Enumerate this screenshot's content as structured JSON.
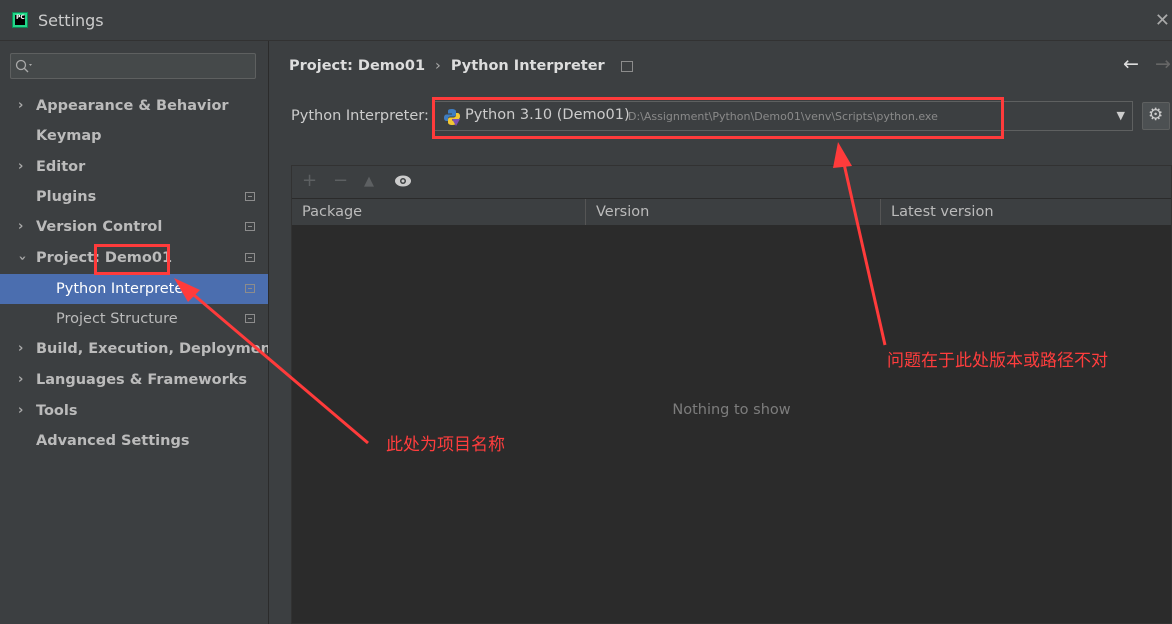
{
  "window": {
    "title": "Settings",
    "close_icon": "close-icon"
  },
  "sidebar": {
    "search_placeholder": "",
    "items": [
      {
        "label": "Appearance & Behavior",
        "expandable": true,
        "bold": true
      },
      {
        "label": "Keymap",
        "bold": true
      },
      {
        "label": "Editor",
        "expandable": true,
        "bold": true
      },
      {
        "label": "Plugins",
        "bold": true,
        "has_icon": true
      },
      {
        "label": "Version Control",
        "expandable": true,
        "bold": true,
        "has_icon": true
      },
      {
        "label_prefix": "Project: ",
        "label_name": "Demo01",
        "expanded": true,
        "bold": true,
        "has_icon": true
      },
      {
        "label": "Python Interpreter",
        "selected": true,
        "has_icon": true
      },
      {
        "label": "Project Structure",
        "has_icon": true
      },
      {
        "label": "Build, Execution, Deployment",
        "expandable": true,
        "bold": true
      },
      {
        "label": "Languages & Frameworks",
        "expandable": true,
        "bold": true
      },
      {
        "label": "Tools",
        "expandable": true,
        "bold": true
      },
      {
        "label": "Advanced Settings",
        "bold": true
      }
    ]
  },
  "breadcrumb": {
    "project": "Project: Demo01",
    "separator": "›",
    "page": "Python Interpreter"
  },
  "nav": {
    "back": "←",
    "forward": "→"
  },
  "interpreter": {
    "label": "Python Interpreter:",
    "name": "Python 3.10 (Demo01)",
    "path": "D:\\Assignment\\Python\\Demo01\\venv\\Scripts\\python.exe"
  },
  "packages": {
    "toolbar": {
      "add": "+",
      "remove": "−",
      "up": "▲",
      "show": "show-icon"
    },
    "columns": [
      "Package",
      "Version",
      "Latest version"
    ],
    "empty": "Nothing to show"
  },
  "annotations": {
    "version_path_issue": "问题在于此处版本或路径不对",
    "project_name_note": "此处为项目名称",
    "color": "#ff3b3b"
  },
  "colors": {
    "selected": "#4b6eaf",
    "background": "#3c3f41",
    "table_bg": "#2b2b2b"
  }
}
